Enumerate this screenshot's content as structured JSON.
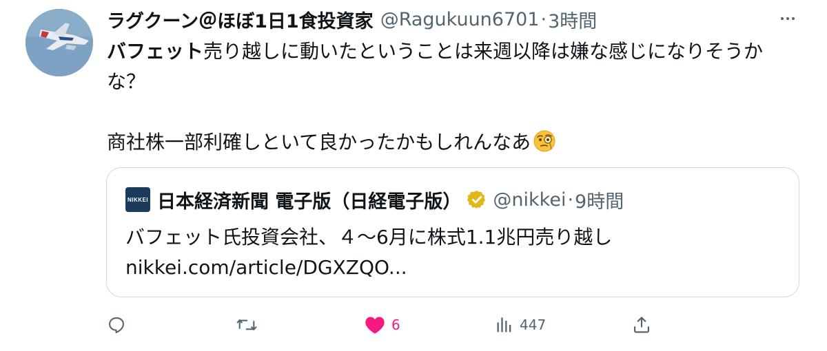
{
  "author": {
    "display_name": "ラグクーン＠ほぼ1日1食投資家",
    "handle": "@Ragukuun6701",
    "separator": "·",
    "time": "3時間"
  },
  "tweet": {
    "bold_prefix": "バフェット",
    "line1_rest": "売り越しに動いたということは来週以降は嫌な感じになりそうか",
    "line2": "な？",
    "line3": "商社株一部利確しといて良かったかもしれんなあ",
    "emoji": "face-with-monocle"
  },
  "quote": {
    "avatar_text": "NIKKEI",
    "display_name": "日本経済新聞 電子版（日経電子版）",
    "verified": true,
    "handle": "@nikkei",
    "separator": "·",
    "time": "9時間",
    "text_line1": "バフェット氏投資会社、４～6月に株式1.1兆円売り越し",
    "text_line2": "nikkei.com/article/DGXZQO..."
  },
  "actions": {
    "reply": {
      "icon": "reply-icon",
      "count": ""
    },
    "retweet": {
      "icon": "retweet-icon",
      "count": ""
    },
    "like": {
      "icon": "heart-icon",
      "count": "6",
      "liked": true
    },
    "views": {
      "icon": "views-icon",
      "count": "447"
    },
    "share": {
      "icon": "share-icon"
    }
  },
  "colors": {
    "text": "#0f1419",
    "secondary": "#536471",
    "like": "#f91880",
    "border": "#cfd9de",
    "verified_gold": "#e2b719"
  }
}
